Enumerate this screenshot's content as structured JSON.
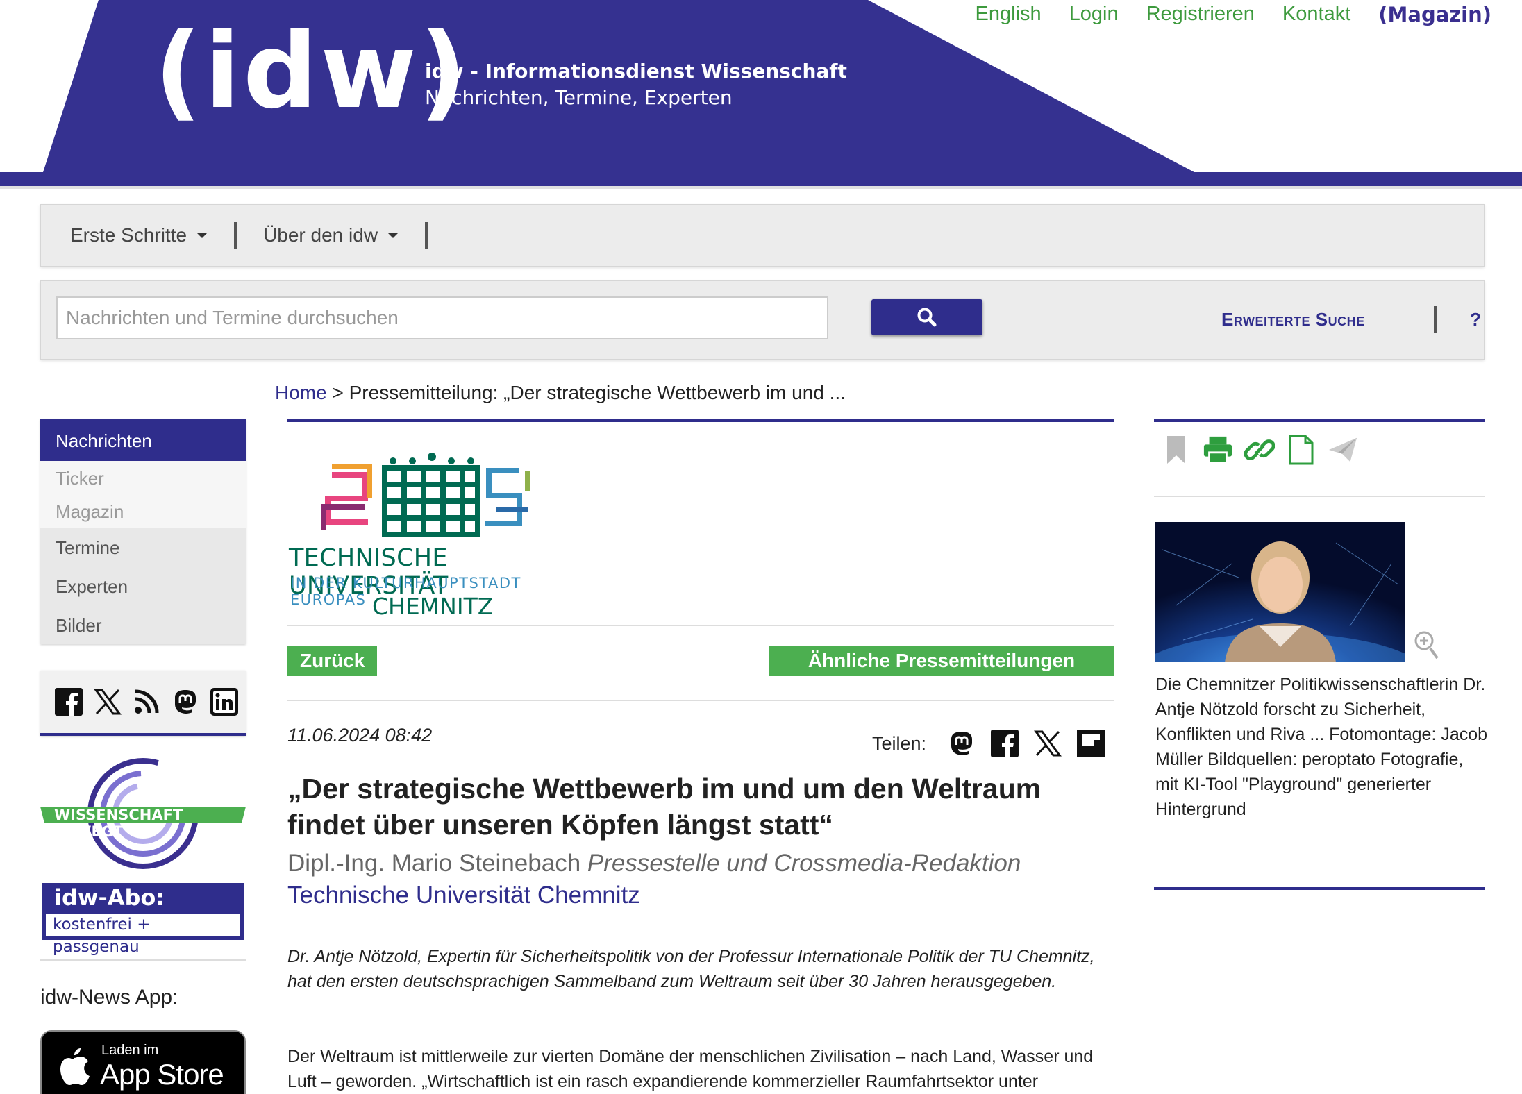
{
  "header": {
    "logo": "(idw)",
    "title": "idw - Informationsdienst Wissenschaft",
    "subtitle": "Nachrichten, Termine, Experten",
    "links": [
      "English",
      "Login",
      "Registrieren",
      "Kontakt"
    ],
    "magazin": "(Magazin)",
    "brand_color": "#353190",
    "link_color": "#3d9a3d"
  },
  "menu": {
    "items": [
      "Erste Schritte",
      "Über den idw"
    ]
  },
  "search": {
    "placeholder": "Nachrichten und Termine durchsuchen",
    "advanced": "Erweiterte Suche",
    "help": "?"
  },
  "breadcrumb": {
    "home": "Home",
    "separator": ">",
    "current": "Pressemitteilung: „Der strategische Wettbewerb im und ..."
  },
  "leftnav": {
    "active": "Nachrichten",
    "sub": [
      "Ticker",
      "Magazin"
    ],
    "items": [
      "Termine",
      "Experten",
      "Bilder"
    ]
  },
  "social_icons": [
    "facebook-icon",
    "x-icon",
    "rss-icon",
    "mastodon-icon",
    "linkedin-icon"
  ],
  "wissenschaft_bewegt": "WISSENSCHAFT BEWEGT",
  "abo": {
    "title": "idw-Abo:",
    "subtitle": "kostenfrei + passgenau"
  },
  "app": {
    "label": "idw-News App:",
    "store_small": "Laden im",
    "store_big": "App Store"
  },
  "article": {
    "institution_logo": {
      "name": "TECHNISCHE UNIVERSITÄT",
      "sub": "IN DER KULTURHAUPTSTADT EUROPAS",
      "city": "CHEMNITZ"
    },
    "back": "Zurück",
    "similar": "Ähnliche Pressemitteilungen",
    "date": "11.06.2024 08:42",
    "share_label": "Teilen:",
    "headline": "„Der strategische Wettbewerb im und um den Weltraum findet über unseren Köpfen längst statt“",
    "author_name": "Dipl.-Ing. Mario Steinebach",
    "author_role": "Pressestelle und Crossmedia-Redaktion",
    "institution": "Technische Universität Chemnitz",
    "lead": "Dr. Antje Nötzold, Expertin für Sicherheitspolitik von der Professur Internationale Politik der TU Chemnitz, hat den ersten deutschsprachigen Sammelband zum Weltraum seit über 30 Jahren herausgegeben.",
    "body": "Der Weltraum ist mittlerweile zur vierten Domäne der menschlichen Zivilisation – nach Land, Wasser und Luft – geworden. „Wirtschaftlich ist ein rasch expandierende kommerzieller Raumfahrtsektor unter"
  },
  "right": {
    "caption": "Die Chemnitzer Politikwissenschaftlerin Dr. Antje Nötzold forscht zu Sicherheit, Konflikten und Riva ... Fotomontage: Jacob Müller Bildquellen: peroptato Fotografie, mit KI-Tool \"Playground\" generierter Hintergrund"
  }
}
